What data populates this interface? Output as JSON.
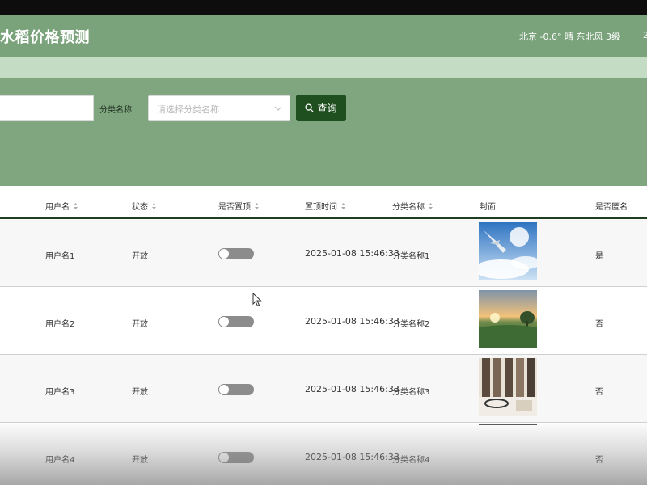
{
  "header": {
    "title": "水稻价格预测",
    "weather": "北京  -0.6°  晴  东北风  3级",
    "weather_extra": "2"
  },
  "search": {
    "field_label": "分类名称",
    "select_placeholder": "请选择分类名称",
    "button_label": "查询"
  },
  "table": {
    "columns": [
      "用户名",
      "状态",
      "是否置顶",
      "置顶时间",
      "分类名称",
      "封面",
      "是否匿名"
    ],
    "rows": [
      {
        "username": "用户名1",
        "status": "开放",
        "pinned": false,
        "pin_time": "2025-01-08 15:46:33",
        "category": "分类名称1",
        "cover": "sky-plane",
        "anonymous": "是"
      },
      {
        "username": "用户名2",
        "status": "开放",
        "pinned": false,
        "pin_time": "2025-01-08 15:46:33",
        "category": "分类名称2",
        "cover": "sunset-field",
        "anonymous": "否"
      },
      {
        "username": "用户名3",
        "status": "开放",
        "pinned": false,
        "pin_time": "2025-01-08 15:46:33",
        "category": "分类名称3",
        "cover": "room-interior",
        "anonymous": "否"
      },
      {
        "username": "用户名4",
        "status": "开放",
        "pinned": false,
        "pin_time": "2025-01-08 15:46:33",
        "category": "分类名称4",
        "cover": "blank",
        "anonymous": "否"
      }
    ]
  },
  "colors": {
    "header_bg": "#7aa27b",
    "nav_bg": "#c4dcc3",
    "panel_bg": "#7fa67f",
    "button_bg": "#1f4e1f",
    "toggle_off": "#8c8c8c"
  }
}
